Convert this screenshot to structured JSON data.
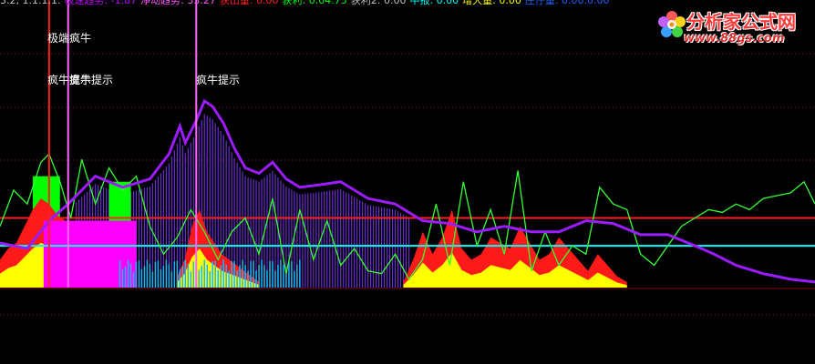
{
  "header": {
    "items": [
      {
        "text": "3.2, 1.1.1.1.",
        "color": "#c0c0c0"
      },
      {
        "text": "极速趋势: -1.87",
        "color": "#c000ff"
      },
      {
        "text": "净动趋势: 33.27",
        "color": "#ff55ff"
      },
      {
        "text": "获出量: 0.00",
        "color": "#ff2020"
      },
      {
        "text": "获利: 0.04.75",
        "color": "#00ff00"
      },
      {
        "text": "获利2: 0.00",
        "color": "#c0c0c0"
      },
      {
        "text": "中报: 0.00",
        "color": "#00ffff"
      },
      {
        "text": "增大量: 0.00",
        "color": "#ffff00"
      },
      {
        "text": "庄仔量: 0.00.0.00",
        "color": "#2060ff"
      }
    ]
  },
  "logo": {
    "title": "分析家公式网",
    "url": "www.88gs.com"
  },
  "annotations": [
    {
      "text": "极端疯牛"
    },
    {
      "text": "疯牛提示"
    },
    {
      "text": "疯牛提示"
    },
    {
      "text": "疯牛提示"
    }
  ],
  "colors": {
    "background": "#000000",
    "red_level": "#ff2020",
    "cyan_level": "#00ffff",
    "purple_line": "#9a1cff",
    "green_line": "#33ff33",
    "purple_bars": "#6a2fd0",
    "red_fill": "#ff1a1a",
    "yellow_fill": "#ffff00",
    "magenta_fill": "#ff00ff",
    "bright_green": "#00ff00",
    "cyan_bars": "#19b7ff",
    "grid": "#8a1a1a"
  },
  "chart_data": {
    "type": "area",
    "x_count": 300,
    "ylim": [
      0,
      100
    ],
    "levels": [
      {
        "name": "red-level",
        "value": 25
      },
      {
        "name": "cyan-level",
        "value": 15
      }
    ],
    "signal_lines": [
      {
        "x": 18,
        "kind": "red"
      },
      {
        "x": 25,
        "kind": "pink"
      },
      {
        "x": 72,
        "kind": "pink"
      }
    ],
    "purple_curve": {
      "x": [
        0,
        10,
        18,
        25,
        35,
        45,
        55,
        62,
        66,
        68,
        70,
        72,
        75,
        78,
        82,
        86,
        90,
        95,
        100,
        105,
        110,
        118,
        125,
        135,
        145,
        155,
        165,
        175,
        185,
        195,
        205,
        215,
        225,
        235,
        245,
        255,
        262,
        270,
        280,
        290,
        299
      ],
      "values": [
        16,
        14,
        24,
        30,
        40,
        36,
        39,
        48,
        58,
        52,
        56,
        60,
        67,
        65,
        59,
        50,
        43,
        41,
        45,
        39,
        36,
        37,
        38,
        32,
        30,
        24,
        23,
        20,
        22,
        20,
        20,
        24,
        23,
        19,
        19,
        15,
        12,
        8,
        5,
        3,
        2
      ]
    },
    "green_curve": {
      "x": [
        0,
        5,
        10,
        15,
        18,
        22,
        26,
        30,
        35,
        40,
        45,
        50,
        55,
        60,
        65,
        70,
        75,
        80,
        85,
        90,
        95,
        100,
        105,
        110,
        115,
        120,
        125,
        130,
        135,
        140,
        145,
        150,
        155,
        160,
        165,
        170,
        175,
        180,
        185,
        190,
        195,
        200,
        205,
        210,
        215,
        220,
        225,
        230,
        235,
        240,
        245,
        250,
        255,
        260,
        265,
        270,
        275,
        280,
        285,
        290,
        295,
        299
      ],
      "values": [
        22,
        35,
        30,
        45,
        48,
        38,
        25,
        46,
        30,
        43,
        35,
        40,
        22,
        12,
        18,
        28,
        20,
        10,
        20,
        25,
        12,
        32,
        5,
        28,
        10,
        24,
        8,
        14,
        6,
        5,
        12,
        3,
        10,
        30,
        8,
        38,
        15,
        28,
        12,
        42,
        6,
        20,
        8,
        15,
        12,
        36,
        30,
        28,
        12,
        8,
        15,
        22,
        25,
        28,
        27,
        30,
        28,
        32,
        33,
        34,
        38,
        30
      ]
    },
    "fill_segments": [
      {
        "start": 0,
        "end": 48,
        "red": [
          10,
          14,
          16,
          22,
          28,
          32,
          30,
          26,
          24,
          22,
          18,
          14,
          10,
          8,
          6,
          4,
          3
        ],
        "yellow_ratio": 0.5
      },
      {
        "start": 65,
        "end": 95,
        "red": [
          4,
          10,
          22,
          28,
          20,
          16,
          12,
          10,
          8,
          6,
          4,
          2
        ],
        "yellow_ratio": 0.5
      },
      {
        "start": 148,
        "end": 230,
        "red": [
          2,
          10,
          20,
          12,
          18,
          28,
          14,
          10,
          12,
          18,
          16,
          14,
          22,
          16,
          10,
          12,
          18,
          14,
          10,
          6,
          12,
          8,
          4,
          2
        ],
        "yellow_ratio": 0.45
      }
    ],
    "purple_bars_range": [
      28,
      150
    ],
    "green_blocks": [
      {
        "start": 12,
        "end": 22,
        "value": 40
      },
      {
        "start": 40,
        "end": 48,
        "value": 38
      }
    ],
    "magenta_fill": {
      "start": 16,
      "end": 50,
      "value": 24
    },
    "cyan_bars": {
      "start": 44,
      "end": 110,
      "value": 10
    }
  }
}
